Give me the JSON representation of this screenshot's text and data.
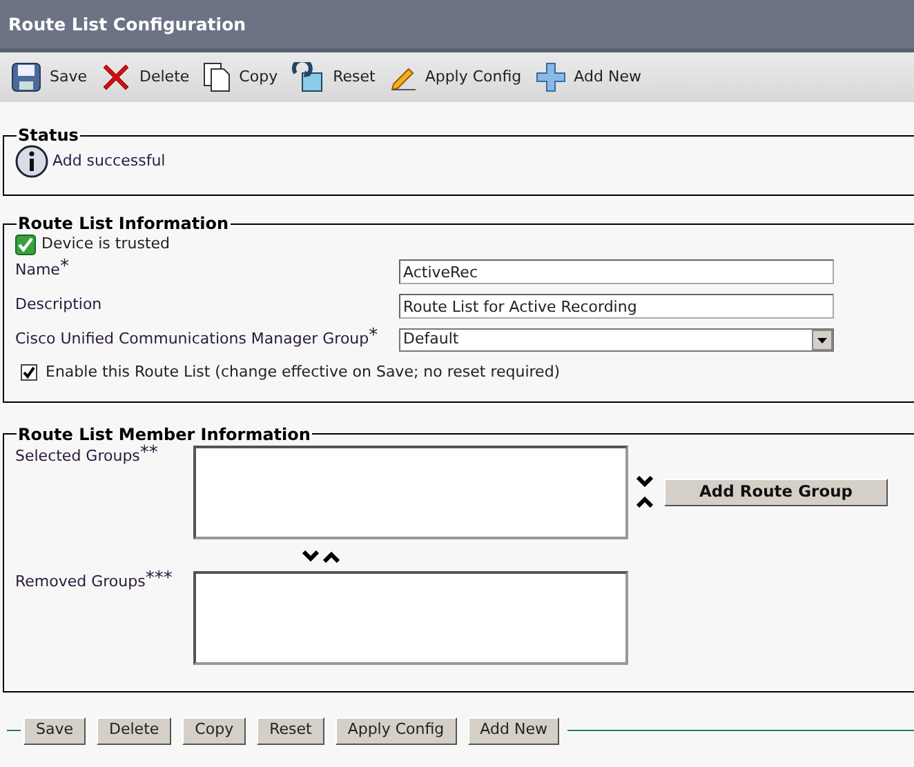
{
  "window": {
    "title": "Route List Configuration"
  },
  "toolbar": [
    {
      "kind": "save",
      "label": "Save"
    },
    {
      "kind": "delete",
      "label": "Delete"
    },
    {
      "kind": "copy",
      "label": "Copy"
    },
    {
      "kind": "reset",
      "label": "Reset"
    },
    {
      "kind": "apply",
      "label": "Apply Config"
    },
    {
      "kind": "add",
      "label": "Add New"
    }
  ],
  "status": {
    "legend": "Status",
    "message": "Add successful"
  },
  "route_list_info": {
    "legend": "Route List Information",
    "trusted": {
      "label": "Device is trusted",
      "checked": true
    },
    "fields": [
      {
        "kind": "text",
        "label": "Name",
        "required_mark": "*",
        "value": "ActiveRec"
      },
      {
        "kind": "text",
        "label": "Description",
        "value": "Route List for Active Recording"
      },
      {
        "kind": "select",
        "label": "Cisco Unified Communications Manager Group",
        "required_mark": "*",
        "value": "Default"
      }
    ],
    "enable": {
      "label": "Enable this Route List (change effective on Save; no reset required)",
      "checked": true
    }
  },
  "member_info": {
    "legend": "Route List Member Information",
    "selected_groups": {
      "label": "Selected Groups",
      "required_mark": "**"
    },
    "add_button": "Add Route Group",
    "removed_groups": {
      "label": "Removed Groups",
      "required_mark": "***"
    }
  },
  "bottom_buttons": [
    "Save",
    "Delete",
    "Copy",
    "Reset",
    "Apply Config",
    "Add New"
  ]
}
